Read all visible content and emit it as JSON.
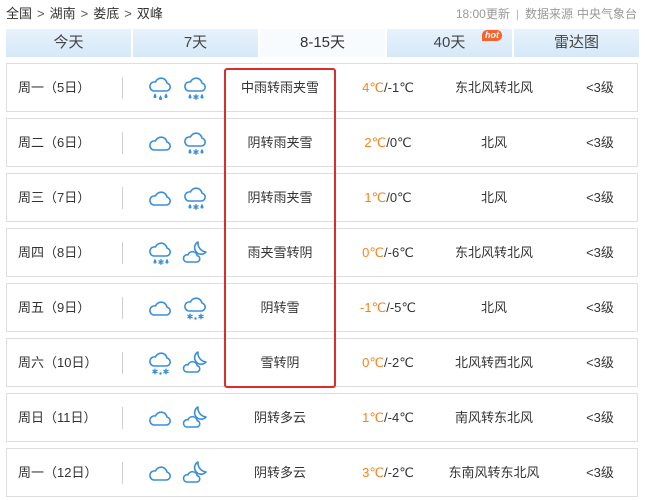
{
  "breadcrumb": {
    "items": [
      "全国",
      "湖南",
      "娄底",
      "双峰"
    ],
    "separator": ">"
  },
  "meta": {
    "updated": "18:00更新",
    "divider": "|",
    "source_label": "数据来源",
    "source": "中央气象台"
  },
  "tabs": [
    {
      "label": "今天"
    },
    {
      "label": "7天"
    },
    {
      "label": "8-15天",
      "active": true
    },
    {
      "label": "40天",
      "badge": "hot"
    },
    {
      "label": "雷达图"
    }
  ],
  "forecast": {
    "temp_separator": "/",
    "rows": [
      {
        "day": "周一（5日）",
        "icons": [
          "rain-icon",
          "sleet-icon"
        ],
        "weather": "中雨转雨夹雪",
        "high": "4℃",
        "low": "-1℃",
        "wind": "东北风转北风",
        "level": "<3级"
      },
      {
        "day": "周二（6日）",
        "icons": [
          "cloudy-icon",
          "sleet-icon"
        ],
        "weather": "阴转雨夹雪",
        "high": "2℃",
        "low": "0℃",
        "wind": "北风",
        "level": "<3级"
      },
      {
        "day": "周三（7日）",
        "icons": [
          "cloudy-icon",
          "sleet-icon"
        ],
        "weather": "阴转雨夹雪",
        "high": "1℃",
        "low": "0℃",
        "wind": "北风",
        "level": "<3级"
      },
      {
        "day": "周四（8日）",
        "icons": [
          "sleet-icon",
          "cloud-moon-icon"
        ],
        "weather": "雨夹雪转阴",
        "high": "0℃",
        "low": "-6℃",
        "wind": "东北风转北风",
        "level": "<3级"
      },
      {
        "day": "周五（9日）",
        "icons": [
          "cloudy-icon",
          "snow-icon"
        ],
        "weather": "阴转雪",
        "high": "-1℃",
        "low": "-5℃",
        "wind": "北风",
        "level": "<3级"
      },
      {
        "day": "周六（10日）",
        "icons": [
          "snow-icon",
          "cloud-moon-icon"
        ],
        "weather": "雪转阴",
        "high": "0℃",
        "low": "-2℃",
        "wind": "北风转西北风",
        "level": "<3级"
      },
      {
        "day": "周日（11日）",
        "icons": [
          "cloudy-icon",
          "cloud-moon-icon"
        ],
        "weather": "阴转多云",
        "high": "1℃",
        "low": "-4℃",
        "wind": "南风转东北风",
        "level": "<3级"
      },
      {
        "day": "周一（12日）",
        "icons": [
          "cloudy-icon",
          "cloud-moon-icon"
        ],
        "weather": "阴转多云",
        "high": "3℃",
        "low": "-2℃",
        "wind": "东南风转东北风",
        "level": "<3级"
      }
    ]
  },
  "colors": {
    "icon_blue": "#3c8ed6",
    "high_temp": "#f5831f",
    "highlight_box": "#de2b2b",
    "hot_badge": "#f5622d"
  }
}
